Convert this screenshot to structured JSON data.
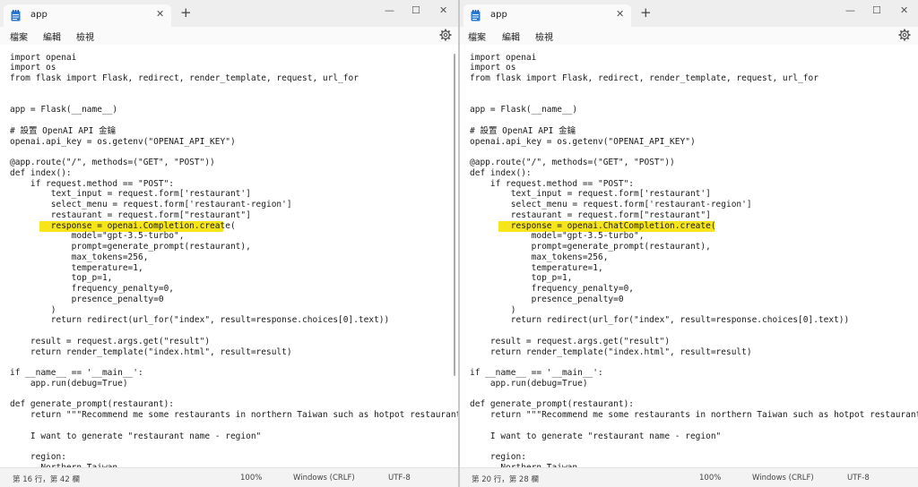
{
  "left_window": {
    "tab": {
      "title": "app",
      "close_glyph": "✕",
      "icon": "notepad-document-icon"
    },
    "new_tab_glyph": "+",
    "window_controls": {
      "minimize": "—",
      "maximize": "☐",
      "close": "✕"
    },
    "menu": {
      "file": "檔案",
      "edit": "編輯",
      "view": "檢視",
      "settings_icon": "gear-icon"
    },
    "code": "import openai\nimport os\nfrom flask import Flask, redirect, render_template, request, url_for\n\n\napp = Flask(__name__)\n\n# 設置 OpenAI API 金鑰\nopenai.api_key = os.getenv(\"OPENAI_API_KEY\")\n\n@app.route(\"/\", methods=(\"GET\", \"POST\"))\ndef index():\n    if request.method == \"POST\":\n        text_input = request.form['restaurant']\n        select_menu = request.form['restaurant-region']\n        restaurant = request.form[\"restaurant\"]\n        response = openai.Completion.create(\n            model=\"gpt-3.5-turbo\",\n            prompt=generate_prompt(restaurant),\n            max_tokens=256,\n            temperature=1,\n            top_p=1,\n            frequency_penalty=0,\n            presence_penalty=0\n        )\n        return redirect(url_for(\"index\", result=response.choices[0].text))\n\n    result = request.args.get(\"result\")\n    return render_template(\"index.html\", result=result)\n\nif __name__ == '__main__':\n    app.run(debug=True)\n\ndef generate_prompt(restaurant):\n    return \"\"\"Recommend me some restaurants in northern Taiwan such as hotpot restaurants\n\n    I want to generate \"restaurant name - region\"\n\n    region:\n      Northern Taiwan",
    "status": {
      "position": "第 16 行，第 42 欄",
      "zoom": "100%",
      "line_ending": "Windows (CRLF)",
      "encoding": "UTF-8"
    }
  },
  "right_window": {
    "tab": {
      "title": "app",
      "close_glyph": "✕",
      "icon": "notepad-document-icon"
    },
    "new_tab_glyph": "+",
    "window_controls": {
      "minimize": "—",
      "maximize": "☐",
      "close": "✕"
    },
    "menu": {
      "file": "檔案",
      "edit": "編輯",
      "view": "檢視",
      "settings_icon": "gear-icon"
    },
    "code": "import openai\nimport os\nfrom flask import Flask, redirect, render_template, request, url_for\n\n\napp = Flask(__name__)\n\n# 設置 OpenAI API 金鑰\nopenai.api_key = os.getenv(\"OPENAI_API_KEY\")\n\n@app.route(\"/\", methods=(\"GET\", \"POST\"))\ndef index():\n    if request.method == \"POST\":\n        text_input = request.form['restaurant']\n        select_menu = request.form['restaurant-region']\n        restaurant = request.form[\"restaurant\"]\n        response = openai.ChatCompletion.create(\n            model=\"gpt-3.5-turbo\",\n            prompt=generate_prompt(restaurant),\n            max_tokens=256,\n            temperature=1,\n            top_p=1,\n            frequency_penalty=0,\n            presence_penalty=0\n        )\n        return redirect(url_for(\"index\", result=response.choices[0].text))\n\n    result = request.args.get(\"result\")\n    return render_template(\"index.html\", result=result)\n\nif __name__ == '__main__':\n    app.run(debug=True)\n\ndef generate_prompt(restaurant):\n    return \"\"\"Recommend me some restaurants in northern Taiwan such as hotpot restaurants\n\n    I want to generate \"restaurant name - region\"\n\n    region:\n      Northern Taiwan",
    "status": {
      "position": "第 20 行，第 28 欄",
      "zoom": "100%",
      "line_ending": "Windows (CRLF)",
      "encoding": "UTF-8"
    }
  },
  "colors": {
    "highlight": "#f5e51a",
    "icon_blue": "#2b7bd3"
  }
}
